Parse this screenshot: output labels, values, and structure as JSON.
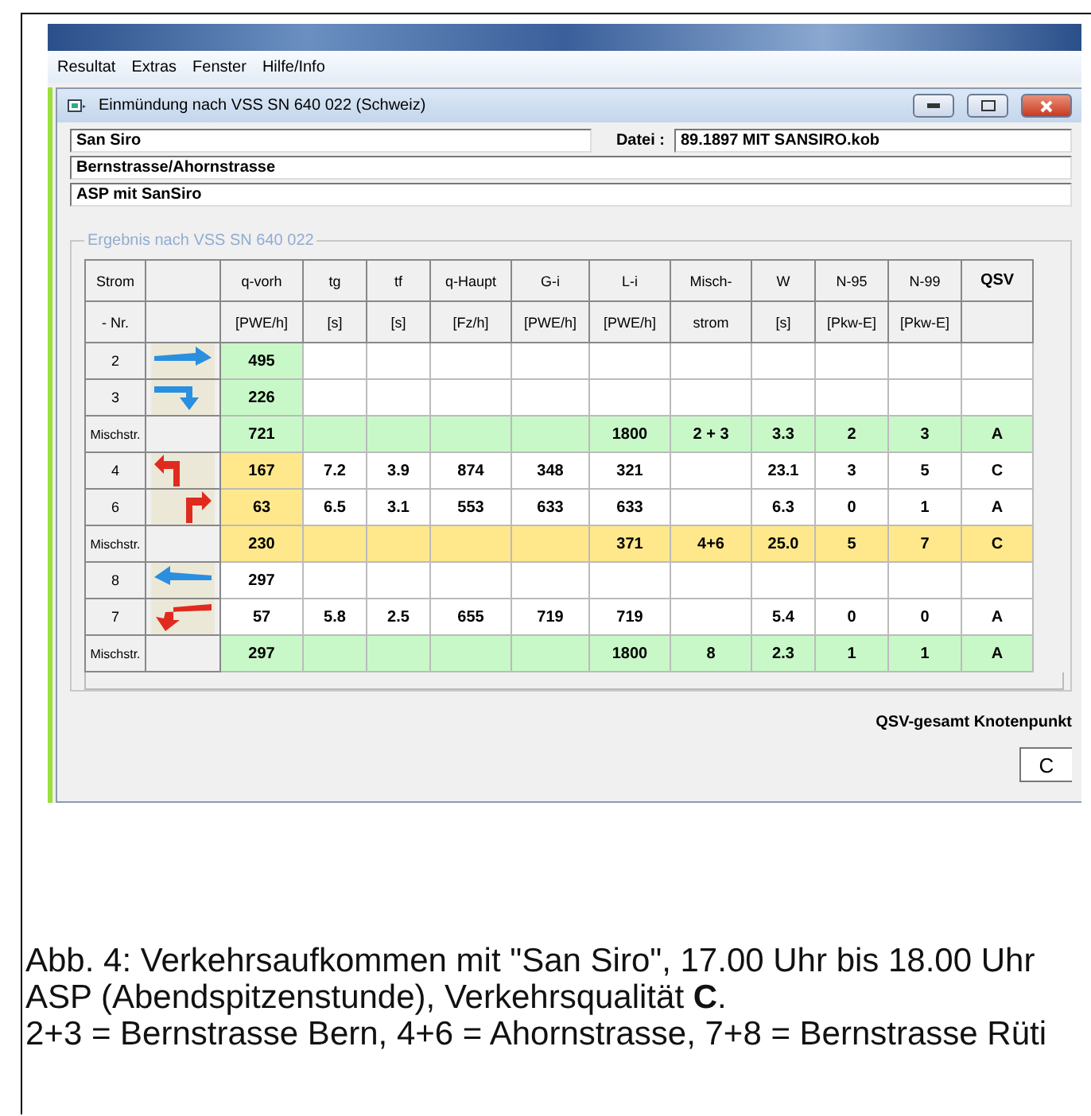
{
  "menu": [
    "Resultat",
    "Extras",
    "Fenster",
    "Hilfe/Info"
  ],
  "window": {
    "title": "Einmündung nach VSS SN 640 022 (Schweiz)"
  },
  "fields": {
    "name": "San Siro",
    "file_label": "Datei :",
    "file": "89.1897 MIT SANSIRO.kob",
    "street": "Bernstrasse/Ahornstrasse",
    "scenario": "ASP mit SanSiro"
  },
  "group": {
    "title": "Ergebnis nach  VSS SN 640 022"
  },
  "table": {
    "columns": [
      {
        "top": "Strom",
        "bottom": "- Nr."
      },
      {},
      {
        "top": "q-vorh",
        "bottom": "[PWE/h]"
      },
      {
        "top": "tg",
        "bottom": "[s]"
      },
      {
        "top": "tf",
        "bottom": "[s]"
      },
      {
        "top": "q-Haupt",
        "bottom": "[Fz/h]"
      },
      {
        "top": "G-i",
        "bottom": "[PWE/h]"
      },
      {
        "top": "L-i",
        "bottom": "[PWE/h]"
      },
      {
        "top": "Misch-",
        "bottom": "strom"
      },
      {
        "top": "W",
        "bottom": "[s]"
      },
      {
        "top": "N-95",
        "bottom": "[Pkw-E]"
      },
      {
        "top": "N-99",
        "bottom": "[Pkw-E]"
      },
      {
        "top": "QSV"
      }
    ],
    "rows": [
      {
        "kind": "stream",
        "color": "#ffffff",
        "cells": [
          "2",
          {
            "kind": "straight-right"
          },
          {
            "text": "495",
            "color": "#c8f8c8"
          },
          null,
          null,
          null,
          null,
          null,
          null,
          null,
          null,
          null,
          null
        ]
      },
      {
        "kind": "stream",
        "color": "#ffffff",
        "cells": [
          "3",
          {
            "kind": "right-turn"
          },
          {
            "text": "226",
            "color": "#c8f8c8"
          },
          null,
          null,
          null,
          null,
          null,
          null,
          null,
          null,
          null,
          null
        ]
      },
      {
        "kind": "mixed",
        "color": "#c8f8c8",
        "cells": [
          "Mischstr.",
          null,
          {
            "text": "721",
            "color": "#c8f8c8"
          },
          null,
          null,
          null,
          null,
          "1800",
          "2 + 3",
          "3.3",
          "2",
          "3",
          "A"
        ]
      },
      {
        "kind": "stream",
        "color": "#ffffff",
        "cells": [
          "4",
          {
            "kind": "left-up"
          },
          {
            "text": "167",
            "color": "#ffe88c"
          },
          "7.2",
          "3.9",
          "874",
          "348",
          "321",
          null,
          "23.1",
          "3",
          "5",
          "C"
        ]
      },
      {
        "kind": "stream",
        "color": "#ffffff",
        "cells": [
          "6",
          {
            "kind": "right-up"
          },
          {
            "text": "63",
            "color": "#ffe88c"
          },
          "6.5",
          "3.1",
          "553",
          "633",
          "633",
          null,
          "6.3",
          "0",
          "1",
          "A"
        ]
      },
      {
        "kind": "mixed",
        "color": "#ffe88c",
        "cells": [
          "Mischstr.",
          null,
          {
            "text": "230",
            "color": "#ffe88c"
          },
          null,
          null,
          null,
          null,
          "371",
          "4+6",
          "25.0",
          "5",
          "7",
          "C"
        ]
      },
      {
        "kind": "stream",
        "color": "#ffffff",
        "cells": [
          "8",
          {
            "kind": "straight-left"
          },
          {
            "text": "297",
            "color": "#ffffff"
          },
          null,
          null,
          null,
          null,
          null,
          null,
          null,
          null,
          null,
          null
        ]
      },
      {
        "kind": "stream",
        "color": "#ffffff",
        "cells": [
          "7",
          {
            "kind": "left-down"
          },
          {
            "text": "57",
            "color": "#ffffff"
          },
          "5.8",
          "2.5",
          "655",
          "719",
          "719",
          null,
          "5.4",
          "0",
          "0",
          "A"
        ]
      },
      {
        "kind": "mixed",
        "color": "#c8f8c8",
        "cells": [
          "Mischstr.",
          null,
          {
            "text": "297",
            "color": "#c8f8c8"
          },
          null,
          null,
          null,
          null,
          "1800",
          "8",
          "2.3",
          "1",
          "1",
          "A"
        ]
      }
    ]
  },
  "summary": {
    "label": "QSV-gesamt Knotenpunkt",
    "value": "C"
  },
  "caption": [
    "Abb. 4: Verkehrsaufkommen mit \"San Siro\", 17.00 Uhr bis 18.00 Uhr ASP (Abendspitzenstunde), Verkehrsqualität **C**.",
    "2+3 = Bernstrasse Bern, 4+6 = Ahornstrasse, 7+8 = Bernstrasse Rüti"
  ]
}
